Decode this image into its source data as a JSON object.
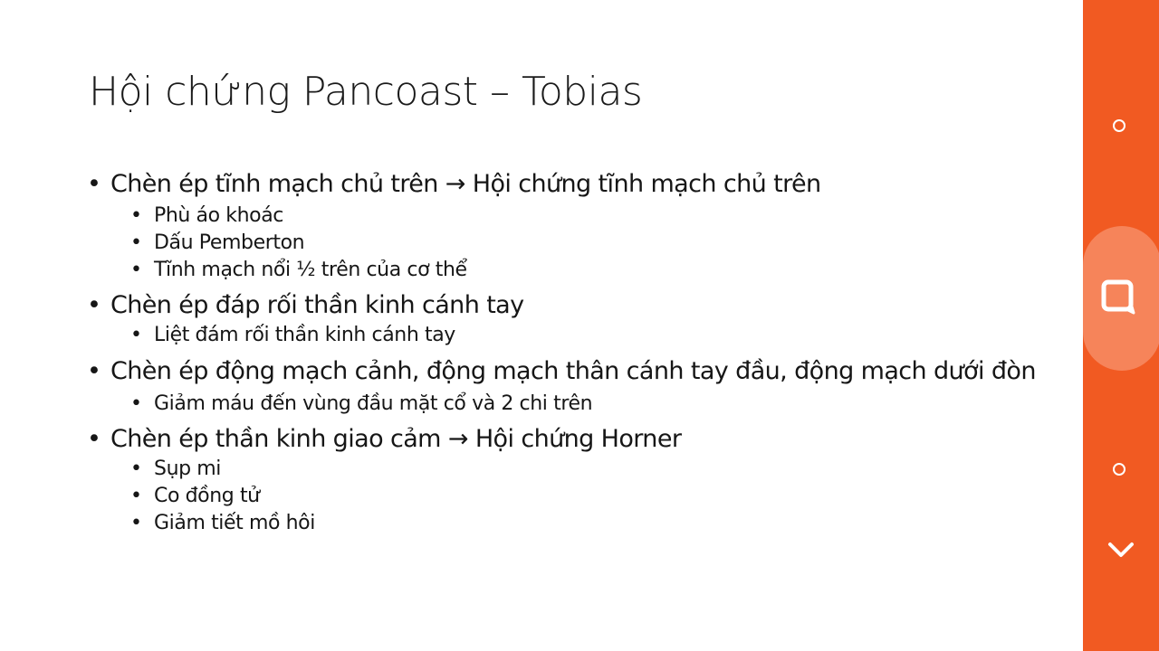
{
  "slide": {
    "title": "Hội chứng Pancoast – Tobias",
    "bullet_char": "•",
    "points": [
      {
        "text": "Chèn ép tĩnh mạch chủ trên → Hội chứng tĩnh mạch chủ trên",
        "subs": [
          "Phù áo khoác",
          "Dấu Pemberton",
          "Tĩnh mạch nổi ½ trên của cơ thể"
        ]
      },
      {
        "text": "Chèn ép đáp rối thần kinh cánh tay",
        "subs": [
          "Liệt đám rối thần kinh cánh tay"
        ]
      },
      {
        "text": "Chèn ép động mạch cảnh, động mạch thân cánh tay đầu, động mạch dưới đòn",
        "subs": [
          "Giảm máu đến vùng đầu mặt cổ và 2 chi trên"
        ]
      },
      {
        "text": "Chèn ép thần kinh giao cảm → Hội chứng Horner",
        "subs": [
          "Sụp mi",
          "Co đồng tử",
          "Giảm tiết mồ hôi"
        ]
      }
    ]
  },
  "sidebar": {
    "background": "#f15a22",
    "highlight": "#f6845a",
    "icons": [
      "circle-icon",
      "quote-icon",
      "circle-icon",
      "chevron-down-icon"
    ]
  }
}
